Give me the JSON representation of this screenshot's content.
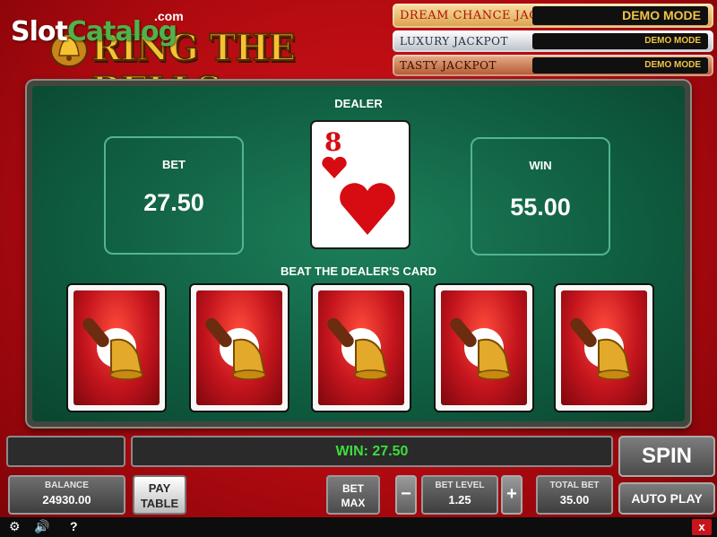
{
  "header": {
    "watermark_part1": "Slot",
    "watermark_part2": "Catalog",
    "watermark_domain": ".com",
    "game_title": "RING THE BELLS"
  },
  "jackpots": [
    {
      "name": "DREAM CHANCE JACKPOT",
      "value": "DEMO MODE"
    },
    {
      "name": "LUXURY JACKPOT",
      "value": "DEMO MODE"
    },
    {
      "name": "TASTY JACKPOT",
      "value": "DEMO MODE"
    }
  ],
  "gamble": {
    "bet_label": "BET",
    "bet_value": "27.50",
    "win_label": "WIN",
    "win_value": "55.00",
    "dealer_label": "DEALER",
    "dealer_card": {
      "rank": "8",
      "suit": "hearts",
      "color": "#d60c12"
    },
    "instruction": "BEAT THE DEALER'S CARD",
    "face_down_cards": 5
  },
  "controls": {
    "win_message": "WIN: 27.50",
    "spin_label": "SPIN",
    "autoplay_label": "AUTO PLAY",
    "balance_label": "BALANCE",
    "balance_value": "24930.00",
    "paytable_line1": "PAY",
    "paytable_line2": "TABLE",
    "betmax_line1": "BET",
    "betmax_line2": "MAX",
    "minus_label": "−",
    "plus_label": "+",
    "bet_level_label": "BET LEVEL",
    "bet_level_value": "1.25",
    "total_bet_label": "TOTAL BET",
    "total_bet_value": "35.00"
  },
  "bottom_bar": {
    "settings_icon": "gear-icon",
    "sound_icon": "speaker-icon",
    "help_label": "?",
    "close_label": "x"
  },
  "colors": {
    "felt": "#0f5d40",
    "win_text": "#3ddd3d",
    "jackpot_value": "#f1c445",
    "card_back": "#c3141d"
  }
}
